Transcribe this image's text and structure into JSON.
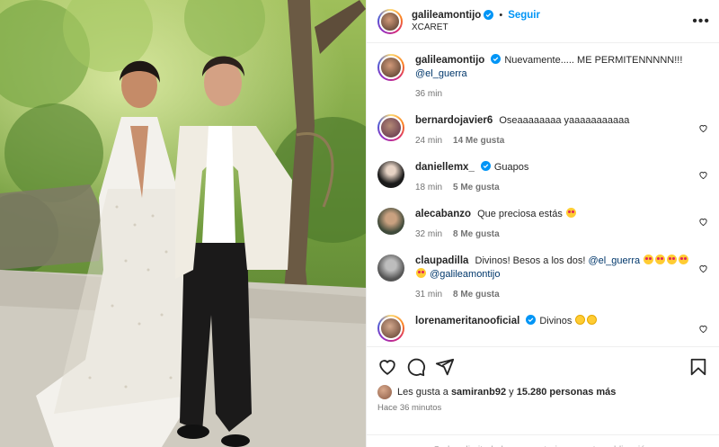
{
  "header": {
    "username": "galileamontijo",
    "dot": "•",
    "follow_label": "Seguir",
    "location": "XCARET",
    "more": "•••"
  },
  "caption": {
    "username": "galileamontijo",
    "text": "Nuevamente..... ME PERMITENNNNN!!!",
    "mention": "@el_guerra",
    "time": "36 min"
  },
  "comments": [
    {
      "username": "bernardojavier6",
      "verified": false,
      "text": "Oseaaaaaaaa yaaaaaaaaaaa",
      "time": "24 min",
      "likes": "14 Me gusta",
      "emoji": ""
    },
    {
      "username": "daniellemx_",
      "verified": true,
      "text": "Guapos",
      "time": "18 min",
      "likes": "5 Me gusta",
      "emoji": ""
    },
    {
      "username": "alecabanzo",
      "verified": false,
      "text": "Que preciosa estás",
      "time": "32 min",
      "likes": "8 Me gusta",
      "emoji": "heart-eyes"
    },
    {
      "username": "claupadilla",
      "verified": false,
      "text": "Divinos! Besos a los dos!",
      "mention1": "@el_guerra",
      "mention2": "@galileamontijo",
      "time": "31 min",
      "likes": "8 Me gusta"
    },
    {
      "username": "lorenameritanooficial",
      "verified": true,
      "text": "Divinos",
      "time": "",
      "likes": ""
    }
  ],
  "footer": {
    "likes_prefix": "Les gusta a",
    "likes_user": "samiranb92",
    "likes_and": "y",
    "likes_count": "15.280 personas más",
    "ago": "Hace 36 minutos",
    "limited": "Se han limitado los comentarios en esta publicación."
  },
  "colors": {
    "accent": "#0095f6",
    "verified": "#0095f6",
    "mention": "#00376b"
  }
}
